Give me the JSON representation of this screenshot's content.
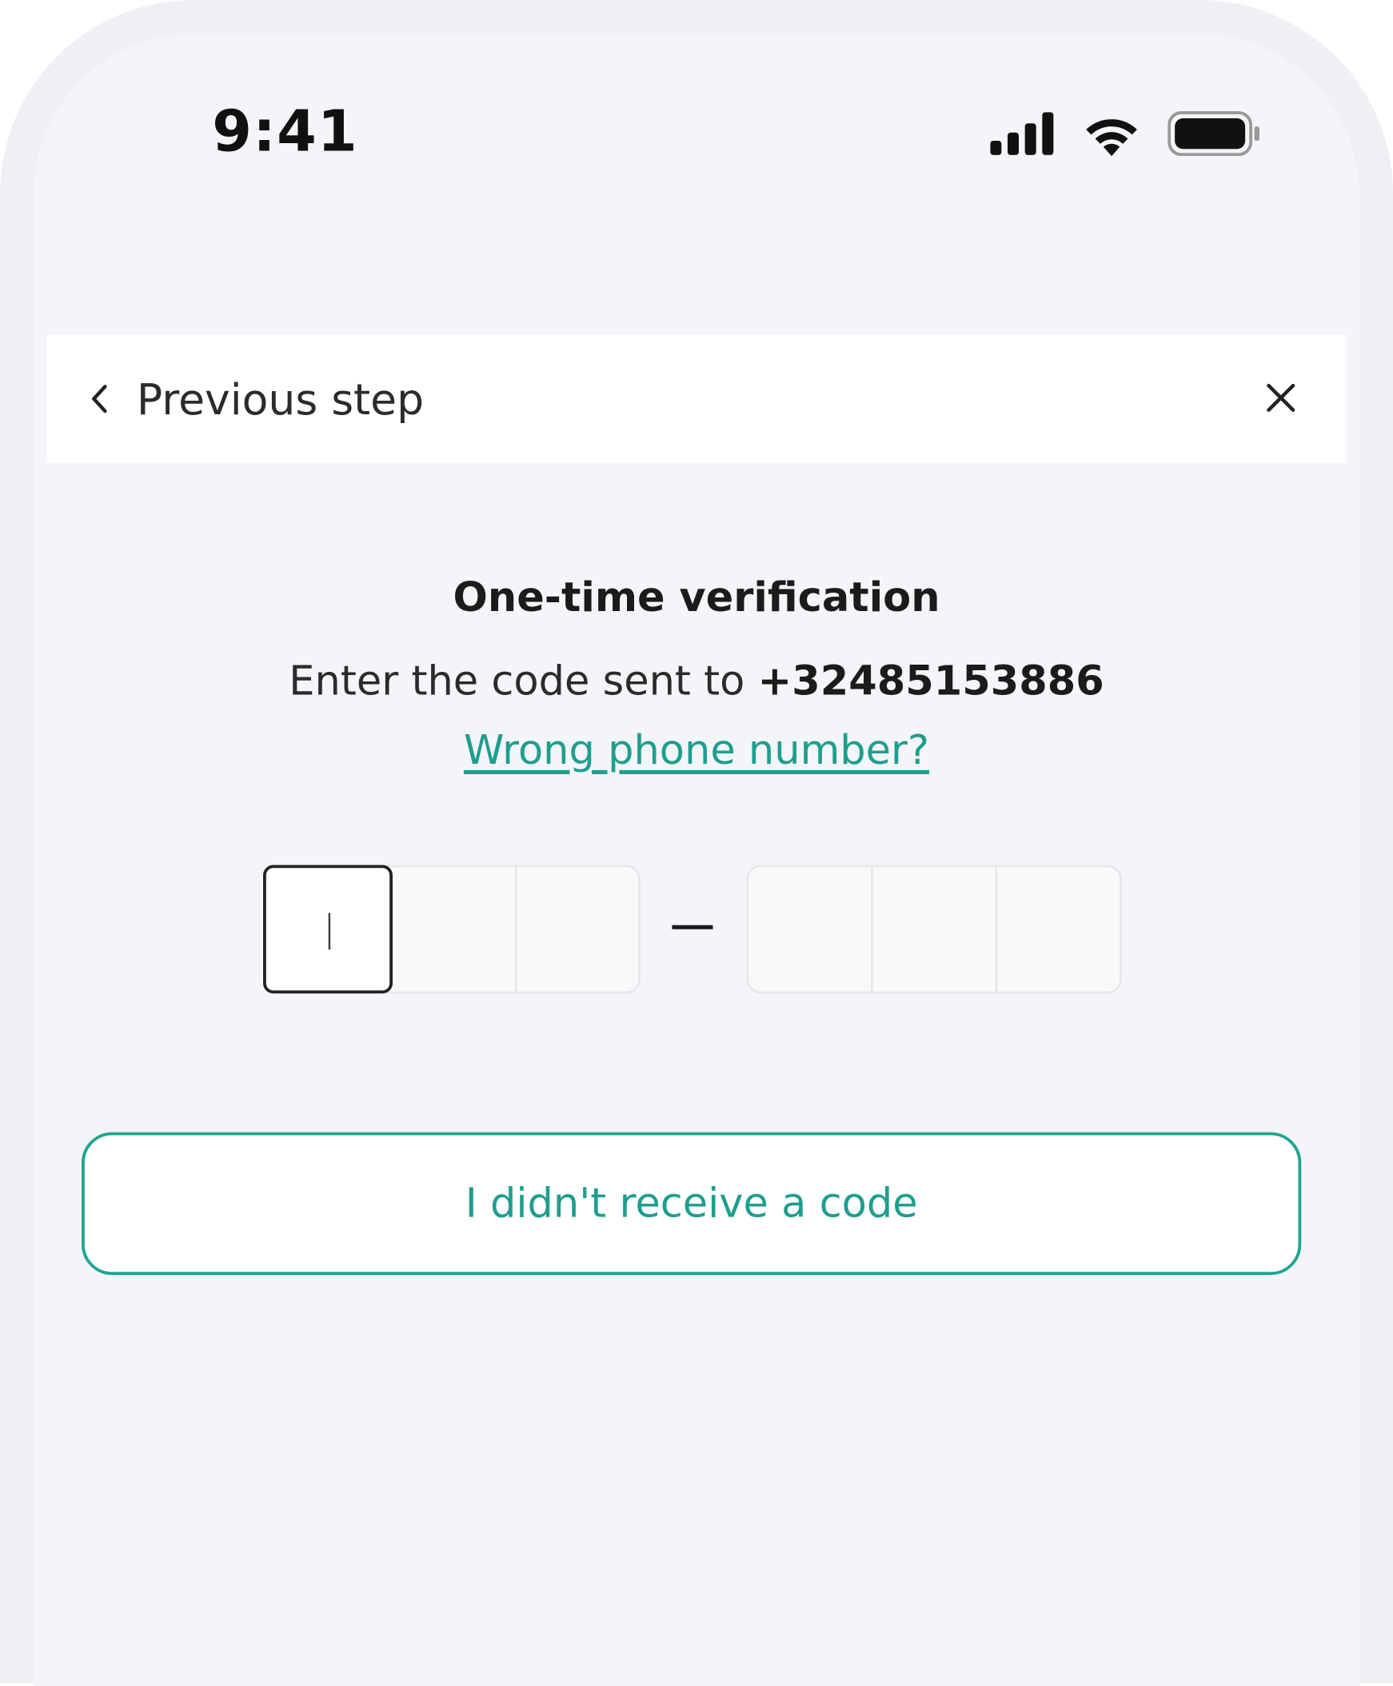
{
  "status_bar": {
    "time": "9:41",
    "icons": [
      "signal-icon",
      "wifi-icon",
      "battery-icon"
    ]
  },
  "nav": {
    "back_label": "Previous step",
    "back_icon": "chevron-left-icon",
    "close_icon": "close-icon"
  },
  "verification": {
    "title": "One-time verification",
    "subtitle_prefix": "Enter the code sent to ",
    "phone_number": "+32485153886",
    "wrong_number_link": "Wrong phone number?",
    "code_digits": [
      "",
      "",
      "",
      "",
      "",
      ""
    ],
    "separator": "–"
  },
  "resend_button": {
    "label": "I didn't receive a code"
  },
  "colors": {
    "accent": "#1f9e8f",
    "background": "#f3f5f8",
    "frame": "#eef0f3"
  }
}
